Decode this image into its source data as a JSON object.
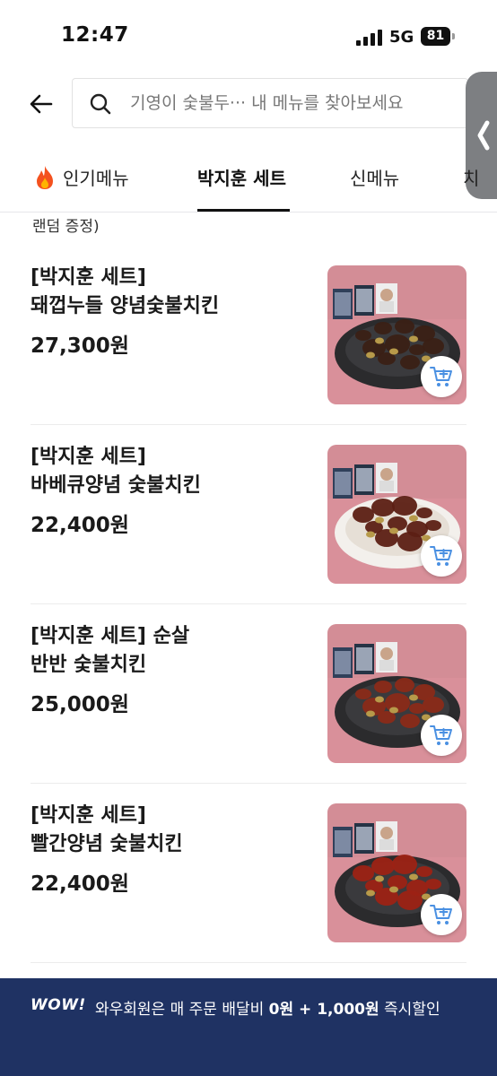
{
  "status_bar": {
    "time": "12:47",
    "network": "5G",
    "battery": "81"
  },
  "header": {
    "back_icon": "arrow-left-icon",
    "search": {
      "icon": "search-icon",
      "placeholder": "기영이 숯불두··· 내 메뉴를 찾아보세요"
    }
  },
  "tabs": [
    {
      "label": "인기메뉴",
      "icon": "fire-icon",
      "active": false
    },
    {
      "label": "박지훈 세트",
      "active": true
    },
    {
      "label": "신메뉴",
      "active": false
    },
    {
      "label": "치",
      "active": false
    }
  ],
  "truncated_text": "랜덤 증정)",
  "menu_items": [
    {
      "name": "[박지훈 세트]\n돼껍누들 양념숯불치킨",
      "price": "27,300원",
      "plate": "#2b2b2d",
      "sauce": "#3a2015"
    },
    {
      "name": "[박지훈 세트]\n바베큐양념 숯불치킨",
      "price": "22,400원",
      "plate": "#f3f0ec",
      "sauce": "#5c1f14"
    },
    {
      "name": "[박지훈 세트] 순살\n반반 숯불치킨",
      "price": "25,000원",
      "plate": "#2b2b2d",
      "sauce": "#8a2a18"
    },
    {
      "name": "[박지훈 세트]\n빨간양념 숯불치킨",
      "price": "22,400원",
      "plate": "#2b2b2d",
      "sauce": "#9c2214"
    }
  ],
  "banner": {
    "logo": "WOW!",
    "text_prefix": "와우회원은 매 주문 배달비 ",
    "text_zero": "0원",
    "text_plus": " + ",
    "text_discount": "1,000원",
    "text_suffix": " 즉시할인"
  },
  "colors": {
    "accent": "#4a90e2",
    "banner_bg": "#1f3263",
    "image_bg": "#d9909a"
  }
}
